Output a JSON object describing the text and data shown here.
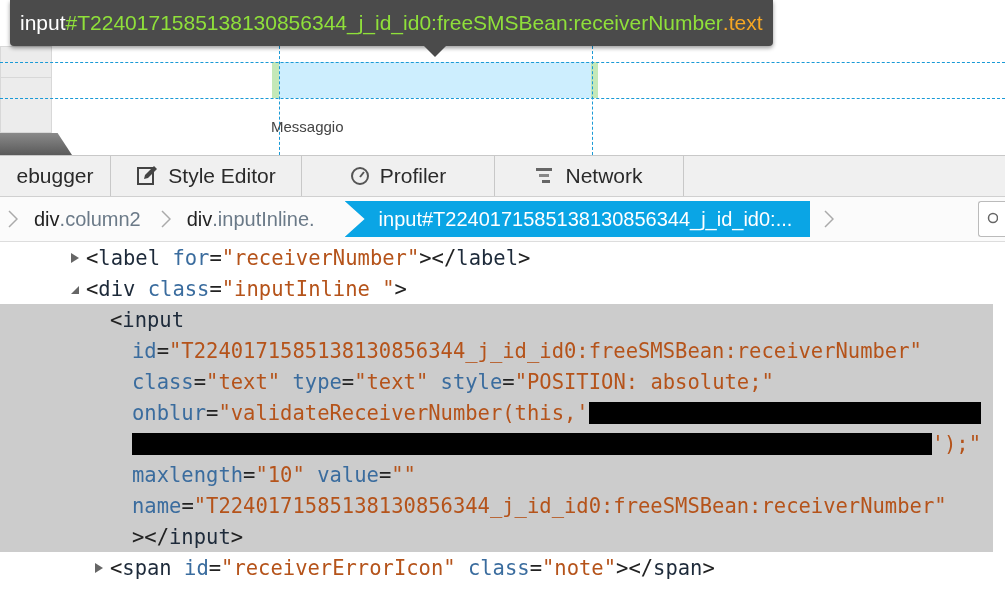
{
  "tooltip": {
    "tag": "input",
    "id": "#T2240171585138130856344_j_id_id0:freeSMSBean:receiverNumber",
    "classes": ".text"
  },
  "preview": {
    "label": "Messaggio"
  },
  "toolbar_tabs": [
    {
      "label": "ebugger",
      "selected": false
    },
    {
      "label": "Style Editor",
      "selected": false
    },
    {
      "label": "Profiler",
      "selected": false
    },
    {
      "label": "Network",
      "selected": false
    }
  ],
  "breadcrumbs": [
    {
      "tag": "div",
      "rest": ".column2",
      "selected": false
    },
    {
      "tag": "div",
      "rest": ".inputInline.",
      "selected": false
    },
    {
      "tag": "input",
      "rest": "#T2240171585138130856344_j_id_id0:...",
      "selected": true
    }
  ],
  "markup": [
    {
      "expanded": false,
      "selected": false,
      "lines": [
        [
          {
            "kind": "punct",
            "text": "<"
          },
          {
            "kind": "tag",
            "text": "label "
          },
          {
            "kind": "attr",
            "text": "for"
          },
          {
            "kind": "punct",
            "text": "="
          },
          {
            "kind": "value",
            "text": "\"receiverNumber\""
          },
          {
            "kind": "punct",
            "text": "></"
          },
          {
            "kind": "tag",
            "text": "label"
          },
          {
            "kind": "punct",
            "text": ">"
          }
        ]
      ]
    },
    {
      "expanded": true,
      "selected": false,
      "lines": [
        [
          {
            "kind": "punct",
            "text": "<"
          },
          {
            "kind": "tag",
            "text": "div "
          },
          {
            "kind": "attr",
            "text": "class"
          },
          {
            "kind": "punct",
            "text": "="
          },
          {
            "kind": "value",
            "text": "\"inputInline \""
          },
          {
            "kind": "punct",
            "text": ">"
          }
        ]
      ],
      "children": [
        {
          "selected": true,
          "lines": [
            [
              {
                "kind": "punct",
                "text": "<"
              },
              {
                "kind": "tag",
                "text": "input"
              }
            ],
            [
              {
                "kind": "attr",
                "text": "id"
              },
              {
                "kind": "punct",
                "text": "="
              },
              {
                "kind": "value",
                "text": "\"T2240171585138130856344_j_id_id0:freeSMSBean:receiverNumber\""
              }
            ],
            [
              {
                "kind": "attr",
                "text": "class"
              },
              {
                "kind": "punct",
                "text": "="
              },
              {
                "kind": "value",
                "text": "\"text\" "
              },
              {
                "kind": "attr",
                "text": "type"
              },
              {
                "kind": "punct",
                "text": "="
              },
              {
                "kind": "value",
                "text": "\"text\" "
              },
              {
                "kind": "attr",
                "text": "style"
              },
              {
                "kind": "punct",
                "text": "="
              },
              {
                "kind": "value",
                "text": "\"POSITION: absolute;\""
              }
            ],
            [
              {
                "kind": "attr",
                "text": "onblur"
              },
              {
                "kind": "punct",
                "text": "="
              },
              {
                "kind": "value",
                "text": "\"validateReceiverNumber(this,'"
              },
              {
                "kind": "redacted"
              }
            ],
            [
              {
                "kind": "redacted"
              },
              {
                "kind": "value",
                "text": "');\""
              }
            ],
            [
              {
                "kind": "attr",
                "text": "maxlength"
              },
              {
                "kind": "punct",
                "text": "="
              },
              {
                "kind": "value",
                "text": "\"10\" "
              },
              {
                "kind": "attr",
                "text": "value"
              },
              {
                "kind": "punct",
                "text": "="
              },
              {
                "kind": "value",
                "text": "\"\""
              }
            ],
            [
              {
                "kind": "attr",
                "text": "name"
              },
              {
                "kind": "punct",
                "text": "="
              },
              {
                "kind": "value",
                "text": "\"T2240171585138130856344_j_id_id0:freeSMSBean:receiverNumber\""
              }
            ],
            [
              {
                "kind": "punct",
                "text": "></"
              },
              {
                "kind": "tag",
                "text": "input"
              },
              {
                "kind": "punct",
                "text": ">"
              }
            ]
          ]
        },
        {
          "expanded": false,
          "selected": false,
          "lines": [
            [
              {
                "kind": "punct",
                "text": "<"
              },
              {
                "kind": "tag",
                "text": "span "
              },
              {
                "kind": "attr",
                "text": "id"
              },
              {
                "kind": "punct",
                "text": "="
              },
              {
                "kind": "value",
                "text": "\"receiverErrorIcon\" "
              },
              {
                "kind": "attr",
                "text": "class"
              },
              {
                "kind": "punct",
                "text": "="
              },
              {
                "kind": "value",
                "text": "\"note\""
              },
              {
                "kind": "punct",
                "text": "></"
              },
              {
                "kind": "tag",
                "text": "span"
              },
              {
                "kind": "punct",
                "text": ">"
              }
            ]
          ]
        }
      ]
    }
  ]
}
